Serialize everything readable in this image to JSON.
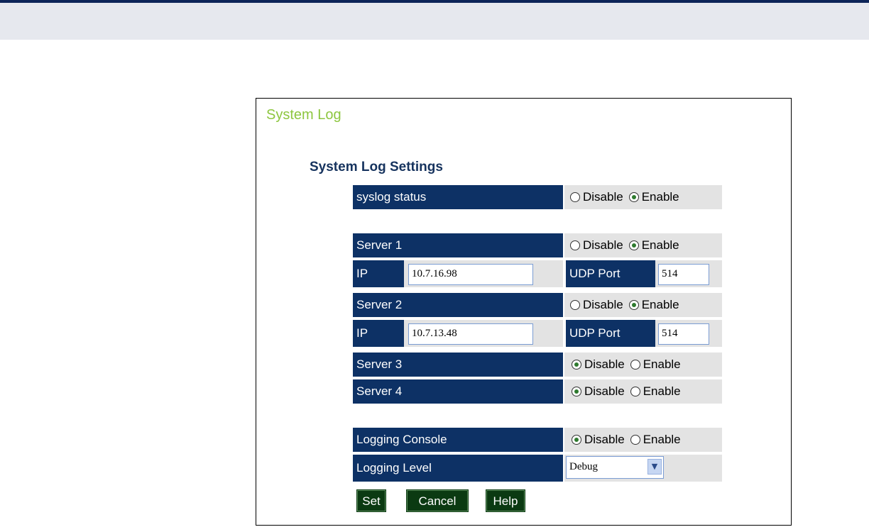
{
  "panel": {
    "title": "System Log",
    "section_title": "System Log Settings"
  },
  "radio": {
    "disable": "Disable",
    "enable": "Enable"
  },
  "syslog_status": {
    "label": "syslog status",
    "value": "Enable"
  },
  "servers": [
    {
      "label": "Server 1",
      "status": "Enable",
      "ip_label": "IP",
      "ip": "10.7.16.98",
      "port_label": "UDP Port",
      "port": "514"
    },
    {
      "label": "Server 2",
      "status": "Enable",
      "ip_label": "IP",
      "ip": "10.7.13.48",
      "port_label": "UDP Port",
      "port": "514"
    },
    {
      "label": "Server 3",
      "status": "Disable"
    },
    {
      "label": "Server 4",
      "status": "Disable"
    }
  ],
  "logging_console": {
    "label": "Logging Console",
    "value": "Disable"
  },
  "logging_level": {
    "label": "Logging Level",
    "value": "Debug"
  },
  "buttons": {
    "set": "Set",
    "cancel": "Cancel",
    "help": "Help"
  },
  "icons": {
    "select_arrow": "chevron-down-icon"
  },
  "colors": {
    "header_cell": "#0d3165",
    "title": "#8dc63f",
    "section": "#16335e",
    "button": "#0b3a12"
  }
}
